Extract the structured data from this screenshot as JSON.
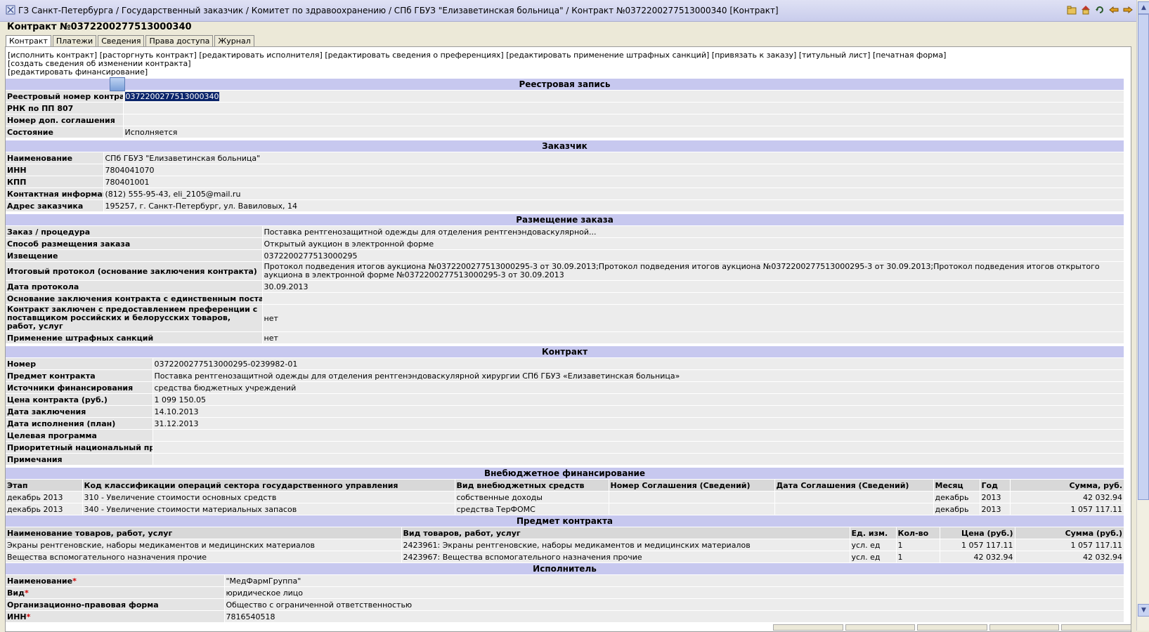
{
  "breadcrumb": "ГЗ Санкт-Петербурга / Государственный заказчик / Комитет по здравоохранению / СПб ГБУЗ \"Елизаветинская больница\" / Контракт №0372200277513000340 [Контракт]",
  "nav_icons": [
    "folder-icon",
    "home-icon",
    "refresh-icon",
    "back-icon",
    "forward-icon"
  ],
  "page_title": "Контракт №0372200277513000340",
  "tabs": [
    "Контракт",
    "Платежи",
    "Сведения",
    "Права доступа",
    "Журнал"
  ],
  "actions": {
    "line1": [
      "[исполнить контракт]",
      "[расторгнуть контракт]",
      "[редактировать исполнителя]",
      "[редактировать сведения о преференциях]",
      "[редактировать применение штрафных санкций]",
      "[привязать к заказу]",
      "[титульный лист]",
      "[печатная форма]"
    ],
    "line2": [
      "[создать сведения об изменении контракта]"
    ],
    "line3": [
      "[редактировать финансирование]"
    ]
  },
  "registry": {
    "header": "Реестровая запись",
    "rows": [
      {
        "label": "Реестровый номер контракта",
        "value": "0372200277513000340"
      },
      {
        "label": "РНК по ПП 807",
        "value": ""
      },
      {
        "label": "Номер доп. соглашения",
        "value": ""
      },
      {
        "label": "Состояние",
        "value": "Исполняется"
      }
    ]
  },
  "customer": {
    "header": "Заказчик",
    "rows": [
      {
        "label": "Наименование",
        "value": "СПб ГБУЗ \"Елизаветинская больница\""
      },
      {
        "label": "ИНН",
        "value": "7804041070"
      },
      {
        "label": "КПП",
        "value": "780401001"
      },
      {
        "label": "Контактная информация",
        "value": "(812) 555-95-43, eli_2105@mail.ru"
      },
      {
        "label": "Адрес заказчика",
        "value": "195257, г. Санкт-Петербург, ул. Вавиловых, 14"
      }
    ]
  },
  "placement": {
    "header": "Размещение заказа",
    "rows": [
      {
        "label": "Заказ / процедура",
        "value": "Поставка рентгенозащитной одежды для отделения рентгенэндоваскулярной..."
      },
      {
        "label": "Способ размещения заказа",
        "value": "Открытый аукцион в электронной форме"
      },
      {
        "label": "Извещение",
        "value": "0372200277513000295"
      },
      {
        "label": "Итоговый протокол (основание заключения контракта)",
        "value": "Протокол подведения итогов аукциона №0372200277513000295-3 от 30.09.2013;Протокол подведения итогов аукциона №0372200277513000295-3 от 30.09.2013;Протокол подведения итогов открытого аукциона в электронной форме №0372200277513000295-3 от 30.09.2013"
      },
      {
        "label": "Дата протокола",
        "value": "30.09.2013"
      },
      {
        "label": "Основание заключения контракта с единственным поставщиком",
        "value": ""
      },
      {
        "label": "Контракт заключен с предоставлением преференции с поставщиком российских и белорусских товаров, работ, услуг",
        "value": "нет"
      },
      {
        "label": "Применение штрафных санкций",
        "value": "нет"
      }
    ]
  },
  "contract": {
    "header": "Контракт",
    "rows": [
      {
        "label": "Номер",
        "value": "0372200277513000295-0239982-01"
      },
      {
        "label": "Предмет контракта",
        "value": "Поставка рентгенозащитной одежды для отделения рентгенэндоваскулярной хирургии СПб ГБУЗ «Елизаветинская больница»"
      },
      {
        "label": "Источники финансирования",
        "value": "средства бюджетных учреждений"
      },
      {
        "label": "Цена контракта (руб.)",
        "value": "1 099 150.05"
      },
      {
        "label": "Дата заключения",
        "value": "14.10.2013"
      },
      {
        "label": "Дата исполнения (план)",
        "value": "31.12.2013"
      },
      {
        "label": "Целевая программа",
        "value": ""
      },
      {
        "label": "Приоритетный национальный проект",
        "value": ""
      },
      {
        "label": "Примечания",
        "value": ""
      }
    ]
  },
  "offbudget": {
    "header": "Внебюджетное финансирование",
    "columns": [
      "Этап",
      "Код классификации операций сектора государственного управления",
      "Вид внебюджетных средств",
      "Номер Соглашения (Сведений)",
      "Дата Соглашения (Сведений)",
      "Месяц",
      "Год",
      "Сумма, руб."
    ],
    "rows": [
      [
        "декабрь 2013",
        "310 - Увеличение стоимости основных средств",
        "собственные доходы",
        "",
        "",
        "декабрь",
        "2013",
        "42 032.94"
      ],
      [
        "декабрь 2013",
        "340 - Увеличение стоимости материальных запасов",
        "средства ТерФОМС",
        "",
        "",
        "декабрь",
        "2013",
        "1 057 117.11"
      ]
    ]
  },
  "subject": {
    "header": "Предмет контракта",
    "columns": [
      "Наименование товаров, работ, услуг",
      "Вид товаров, работ, услуг",
      "Ед. изм.",
      "Кол-во",
      "Цена (руб.)",
      "Сумма (руб.)"
    ],
    "rows": [
      [
        "Экраны рентгеновские, наборы медикаментов и медицинских материалов",
        "2423961: Экраны рентгеновские, наборы медикаментов и медицинских материалов",
        "усл. ед",
        "1",
        "1 057 117.11",
        "1 057 117.11"
      ],
      [
        "Вещества вспомогательного назначения прочие",
        "2423967: Вещества вспомогательного назначения прочие",
        "усл. ед",
        "1",
        "42 032.94",
        "42 032.94"
      ]
    ]
  },
  "executor": {
    "header": "Исполнитель",
    "rows": [
      {
        "label": "Наименование",
        "required": "*",
        "value": "\"МедФармГруппа\""
      },
      {
        "label": "Вид",
        "required": "*",
        "value": "юридическое лицо"
      },
      {
        "label": "Организационно-правовая форма",
        "required": "",
        "value": "Общество с ограниченной ответственностью"
      },
      {
        "label": "ИНН",
        "required": "*",
        "value": "7816540518"
      }
    ]
  }
}
